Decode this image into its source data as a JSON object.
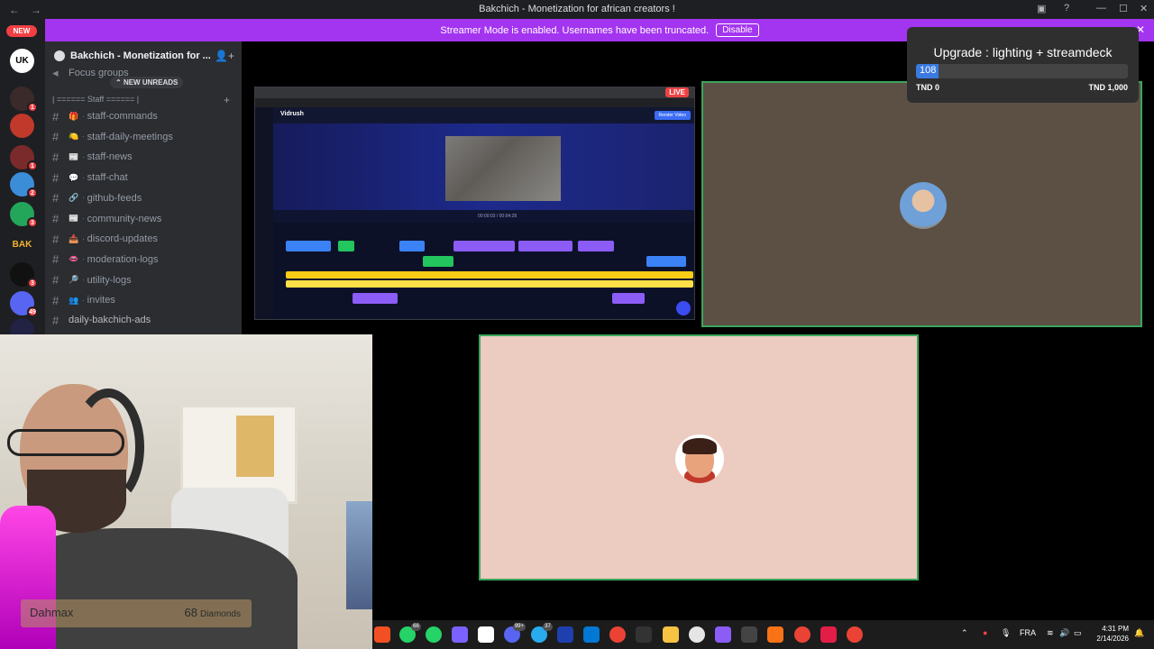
{
  "window": {
    "title": "Bakchich - Monetization for african creators !",
    "back": "←",
    "forward": "→",
    "minimize": "—",
    "maximize": "☐",
    "close": "✕",
    "help": "?"
  },
  "rail": {
    "new_label": "NEW",
    "servers": [
      {
        "label": "UK",
        "color": "#ffffff",
        "text_color": "#000000",
        "badge": ""
      },
      {
        "label": "",
        "color": "#3b2a2a",
        "text_color": "#ffffff",
        "badge": "1"
      },
      {
        "label": "",
        "color": "#c0392b",
        "text_color": "#ffffff",
        "badge": ""
      },
      {
        "label": "",
        "color": "#7a2a2a",
        "text_color": "#ffffff",
        "badge": "1"
      },
      {
        "label": "",
        "color": "#3b8dd8",
        "text_color": "#ffffff",
        "badge": "2"
      },
      {
        "label": "",
        "color": "#23a55a",
        "text_color": "#ffffff",
        "badge": "3"
      },
      {
        "label": "BAK",
        "color": "#1e1f22",
        "text_color": "#f0b132",
        "badge": ""
      },
      {
        "label": "",
        "color": "#111111",
        "text_color": "#ffffff",
        "badge": "3"
      },
      {
        "label": "",
        "color": "#5865f2",
        "text_color": "#ffffff",
        "badge": "49"
      },
      {
        "label": "",
        "color": "#222244",
        "text_color": "#ffffff",
        "badge": "23"
      }
    ]
  },
  "banner": {
    "text": "Streamer Mode is enabled. Usernames have been truncated.",
    "button": "Disable",
    "close": "✕"
  },
  "sidebar": {
    "guild_name": "Bakchich - Monetization for ...",
    "unreads_label": "NEW UNREADS",
    "focus_groups": "Focus groups",
    "category": "| ====== Staff ====== |",
    "channels": [
      {
        "name": "staff-commands",
        "emoji": "🎁"
      },
      {
        "name": "staff-daily-meetings",
        "emoji": "🍋"
      },
      {
        "name": "staff-news",
        "emoji": "📰"
      },
      {
        "name": "staff-chat",
        "emoji": "💬"
      },
      {
        "name": "github-feeds",
        "emoji": "🔗"
      },
      {
        "name": "community-news",
        "emoji": "📰"
      },
      {
        "name": "discord-updates",
        "emoji": "📥"
      },
      {
        "name": "moderation-logs",
        "emoji": "👄"
      },
      {
        "name": "utility-logs",
        "emoji": "🔎"
      },
      {
        "name": "invites",
        "emoji": "👥"
      }
    ],
    "plain_channel": "daily-bakchich-ads"
  },
  "screenshare": {
    "live": "LIVE",
    "app_name": "Vidrush",
    "render_label": "Render Video",
    "timecode": "00:00:03 / 00:04:28"
  },
  "upgrade": {
    "title": "Upgrade : lighting + streamdeck",
    "value": "108",
    "min_label": "TND 0",
    "max_label": "TND 1,000",
    "progress_fraction": 0.108
  },
  "donation": {
    "name": "Dahmax",
    "amount": "68",
    "unit": "Diamonds"
  },
  "taskbar": {
    "language": "FRA",
    "time": "4:31 PM",
    "date": "2/14/2026",
    "badges": {
      "whatsapp": "66",
      "discord": "99+",
      "telegram": "37"
    }
  }
}
